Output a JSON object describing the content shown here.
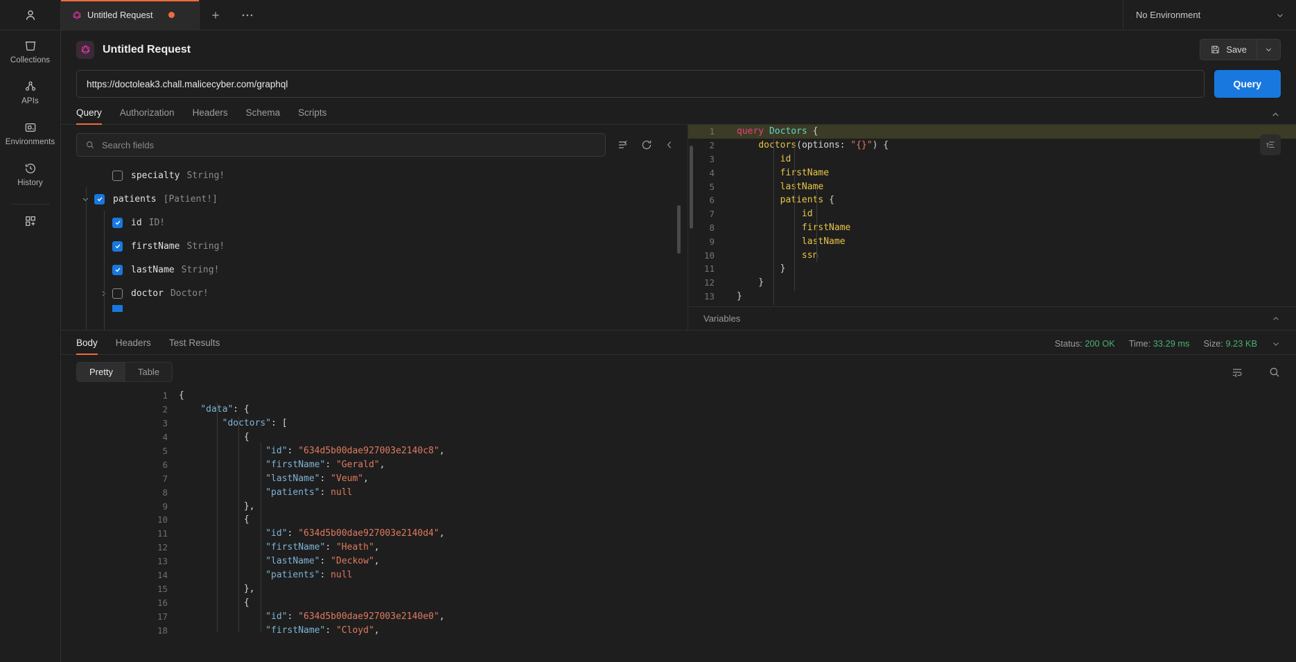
{
  "rail": {
    "items": [
      {
        "icon": "user-icon",
        "label": ""
      },
      {
        "icon": "collections-icon",
        "label": "Collections"
      },
      {
        "icon": "apis-icon",
        "label": "APIs"
      },
      {
        "icon": "environments-icon",
        "label": "Environments"
      },
      {
        "icon": "history-icon",
        "label": "History"
      },
      {
        "icon": "new-icon",
        "label": ""
      }
    ]
  },
  "tabbar": {
    "tab_title": "Untitled Request",
    "tab_icon": "graphql-icon",
    "unsaved_dot": true,
    "new_tab_icon": "plus-icon",
    "more_icon": "ellipsis-icon",
    "environment": "No Environment",
    "environment_caret": "chevron-down-icon"
  },
  "request": {
    "title": "Untitled Request",
    "logo_icon": "graphql-icon",
    "save_label": "Save",
    "save_icon": "floppy-icon",
    "save_caret_icon": "chevron-down-icon",
    "url": "https://doctoleak3.chall.malicecyber.com/graphql",
    "send_label": "Query",
    "tabs": [
      {
        "label": "Query",
        "active": true
      },
      {
        "label": "Authorization",
        "active": false
      },
      {
        "label": "Headers",
        "active": false
      },
      {
        "label": "Schema",
        "active": false
      },
      {
        "label": "Scripts",
        "active": false
      }
    ],
    "collapse_icon": "chevron-up-icon"
  },
  "explorer": {
    "search_placeholder": "Search fields",
    "search_icon": "search-icon",
    "filter_icon": "filter-icon",
    "refresh_icon": "refresh-icon",
    "collapse_icon": "chevron-left-icon",
    "fields": [
      {
        "name": "specialty",
        "type": "String!",
        "checked": false,
        "indent": 1,
        "arrow": "none"
      },
      {
        "name": "patients",
        "type": "[Patient!]",
        "checked": true,
        "indent": 0,
        "arrow": "down"
      },
      {
        "name": "id",
        "type": "ID!",
        "checked": true,
        "indent": 2,
        "arrow": "none"
      },
      {
        "name": "firstName",
        "type": "String!",
        "checked": true,
        "indent": 2,
        "arrow": "none"
      },
      {
        "name": "lastName",
        "type": "String!",
        "checked": true,
        "indent": 2,
        "arrow": "none"
      },
      {
        "name": "doctor",
        "type": "Doctor!",
        "checked": false,
        "indent": 1,
        "arrow": "right"
      }
    ]
  },
  "editor": {
    "format_icon": "format-icon",
    "variables_label": "Variables",
    "variables_caret_icon": "chevron-up-icon",
    "lines": [
      {
        "n": "1",
        "highlight": true,
        "tokens": [
          {
            "t": "query",
            "c": "k-kw"
          },
          {
            "t": " ",
            "c": "k-pn"
          },
          {
            "t": "Doctors",
            "c": "k-op"
          },
          {
            "t": " {",
            "c": "k-pn"
          }
        ]
      },
      {
        "n": "2",
        "highlight": false,
        "tokens": [
          {
            "t": "    ",
            "c": "k-pn"
          },
          {
            "t": "doctors",
            "c": "k-fld"
          },
          {
            "t": "(",
            "c": "k-pn"
          },
          {
            "t": "options",
            "c": "k-arg"
          },
          {
            "t": ": ",
            "c": "k-pn"
          },
          {
            "t": "\"{}\"",
            "c": "k-str"
          },
          {
            "t": ") {",
            "c": "k-pn"
          }
        ]
      },
      {
        "n": "3",
        "highlight": false,
        "tokens": [
          {
            "t": "        ",
            "c": "k-pn"
          },
          {
            "t": "id",
            "c": "k-fld"
          }
        ]
      },
      {
        "n": "4",
        "highlight": false,
        "tokens": [
          {
            "t": "        ",
            "c": "k-pn"
          },
          {
            "t": "firstName",
            "c": "k-fld"
          }
        ]
      },
      {
        "n": "5",
        "highlight": false,
        "tokens": [
          {
            "t": "        ",
            "c": "k-pn"
          },
          {
            "t": "lastName",
            "c": "k-fld"
          }
        ]
      },
      {
        "n": "6",
        "highlight": false,
        "tokens": [
          {
            "t": "        ",
            "c": "k-pn"
          },
          {
            "t": "patients",
            "c": "k-fld"
          },
          {
            "t": " {",
            "c": "k-pn"
          }
        ]
      },
      {
        "n": "7",
        "highlight": false,
        "tokens": [
          {
            "t": "            ",
            "c": "k-pn"
          },
          {
            "t": "id",
            "c": "k-fld"
          }
        ]
      },
      {
        "n": "8",
        "highlight": false,
        "tokens": [
          {
            "t": "            ",
            "c": "k-pn"
          },
          {
            "t": "firstName",
            "c": "k-fld"
          }
        ]
      },
      {
        "n": "9",
        "highlight": false,
        "tokens": [
          {
            "t": "            ",
            "c": "k-pn"
          },
          {
            "t": "lastName",
            "c": "k-fld"
          }
        ]
      },
      {
        "n": "10",
        "highlight": false,
        "tokens": [
          {
            "t": "            ",
            "c": "k-pn"
          },
          {
            "t": "ssn",
            "c": "k-fld"
          }
        ]
      },
      {
        "n": "11",
        "highlight": false,
        "tokens": [
          {
            "t": "        }",
            "c": "k-pn"
          }
        ]
      },
      {
        "n": "12",
        "highlight": false,
        "tokens": [
          {
            "t": "    }",
            "c": "k-pn"
          }
        ]
      },
      {
        "n": "13",
        "highlight": false,
        "tokens": [
          {
            "t": "}",
            "c": "k-pn"
          }
        ]
      }
    ]
  },
  "response": {
    "tabs": [
      {
        "label": "Body",
        "active": true
      },
      {
        "label": "Headers",
        "active": false
      },
      {
        "label": "Test Results",
        "active": false
      }
    ],
    "status_label": "Status:",
    "status_value": "200 OK",
    "time_label": "Time:",
    "time_value": "33.29 ms",
    "size_label": "Size:",
    "size_value": "9.23 KB",
    "status_caret_icon": "chevron-down-icon",
    "views": [
      {
        "label": "Pretty",
        "active": true
      },
      {
        "label": "Table",
        "active": false
      }
    ],
    "wrap_icon": "word-wrap-icon",
    "search_icon": "search-icon",
    "lines": [
      {
        "n": "1",
        "tokens": [
          {
            "t": "{",
            "c": "j-pn"
          }
        ]
      },
      {
        "n": "2",
        "tokens": [
          {
            "t": "    ",
            "c": "j-pn"
          },
          {
            "t": "\"data\"",
            "c": "j-key"
          },
          {
            "t": ": {",
            "c": "j-pn"
          }
        ]
      },
      {
        "n": "3",
        "tokens": [
          {
            "t": "        ",
            "c": "j-pn"
          },
          {
            "t": "\"doctors\"",
            "c": "j-key"
          },
          {
            "t": ": [",
            "c": "j-pn"
          }
        ]
      },
      {
        "n": "4",
        "tokens": [
          {
            "t": "            {",
            "c": "j-pn"
          }
        ]
      },
      {
        "n": "5",
        "tokens": [
          {
            "t": "                ",
            "c": "j-pn"
          },
          {
            "t": "\"id\"",
            "c": "j-key"
          },
          {
            "t": ": ",
            "c": "j-pn"
          },
          {
            "t": "\"634d5b00dae927003e2140c8\"",
            "c": "j-str"
          },
          {
            "t": ",",
            "c": "j-pn"
          }
        ]
      },
      {
        "n": "6",
        "tokens": [
          {
            "t": "                ",
            "c": "j-pn"
          },
          {
            "t": "\"firstName\"",
            "c": "j-key"
          },
          {
            "t": ": ",
            "c": "j-pn"
          },
          {
            "t": "\"Gerald\"",
            "c": "j-str"
          },
          {
            "t": ",",
            "c": "j-pn"
          }
        ]
      },
      {
        "n": "7",
        "tokens": [
          {
            "t": "                ",
            "c": "j-pn"
          },
          {
            "t": "\"lastName\"",
            "c": "j-key"
          },
          {
            "t": ": ",
            "c": "j-pn"
          },
          {
            "t": "\"Veum\"",
            "c": "j-str"
          },
          {
            "t": ",",
            "c": "j-pn"
          }
        ]
      },
      {
        "n": "8",
        "tokens": [
          {
            "t": "                ",
            "c": "j-pn"
          },
          {
            "t": "\"patients\"",
            "c": "j-key"
          },
          {
            "t": ": ",
            "c": "j-pn"
          },
          {
            "t": "null",
            "c": "j-null"
          }
        ]
      },
      {
        "n": "9",
        "tokens": [
          {
            "t": "            },",
            "c": "j-pn"
          }
        ]
      },
      {
        "n": "10",
        "tokens": [
          {
            "t": "            {",
            "c": "j-pn"
          }
        ]
      },
      {
        "n": "11",
        "tokens": [
          {
            "t": "                ",
            "c": "j-pn"
          },
          {
            "t": "\"id\"",
            "c": "j-key"
          },
          {
            "t": ": ",
            "c": "j-pn"
          },
          {
            "t": "\"634d5b00dae927003e2140d4\"",
            "c": "j-str"
          },
          {
            "t": ",",
            "c": "j-pn"
          }
        ]
      },
      {
        "n": "12",
        "tokens": [
          {
            "t": "                ",
            "c": "j-pn"
          },
          {
            "t": "\"firstName\"",
            "c": "j-key"
          },
          {
            "t": ": ",
            "c": "j-pn"
          },
          {
            "t": "\"Heath\"",
            "c": "j-str"
          },
          {
            "t": ",",
            "c": "j-pn"
          }
        ]
      },
      {
        "n": "13",
        "tokens": [
          {
            "t": "                ",
            "c": "j-pn"
          },
          {
            "t": "\"lastName\"",
            "c": "j-key"
          },
          {
            "t": ": ",
            "c": "j-pn"
          },
          {
            "t": "\"Deckow\"",
            "c": "j-str"
          },
          {
            "t": ",",
            "c": "j-pn"
          }
        ]
      },
      {
        "n": "14",
        "tokens": [
          {
            "t": "                ",
            "c": "j-pn"
          },
          {
            "t": "\"patients\"",
            "c": "j-key"
          },
          {
            "t": ": ",
            "c": "j-pn"
          },
          {
            "t": "null",
            "c": "j-null"
          }
        ]
      },
      {
        "n": "15",
        "tokens": [
          {
            "t": "            },",
            "c": "j-pn"
          }
        ]
      },
      {
        "n": "16",
        "tokens": [
          {
            "t": "            {",
            "c": "j-pn"
          }
        ]
      },
      {
        "n": "17",
        "tokens": [
          {
            "t": "                ",
            "c": "j-pn"
          },
          {
            "t": "\"id\"",
            "c": "j-key"
          },
          {
            "t": ": ",
            "c": "j-pn"
          },
          {
            "t": "\"634d5b00dae927003e2140e0\"",
            "c": "j-str"
          },
          {
            "t": ",",
            "c": "j-pn"
          }
        ]
      },
      {
        "n": "18",
        "tokens": [
          {
            "t": "                ",
            "c": "j-pn"
          },
          {
            "t": "\"firstName\"",
            "c": "j-key"
          },
          {
            "t": ": ",
            "c": "j-pn"
          },
          {
            "t": "\"Cloyd\"",
            "c": "j-str"
          },
          {
            "t": ",",
            "c": "j-pn"
          }
        ]
      }
    ]
  },
  "colors": {
    "accent": "#f26b3a",
    "primary": "#1878e0",
    "success": "#4caf72",
    "background": "#1e1e1e"
  }
}
